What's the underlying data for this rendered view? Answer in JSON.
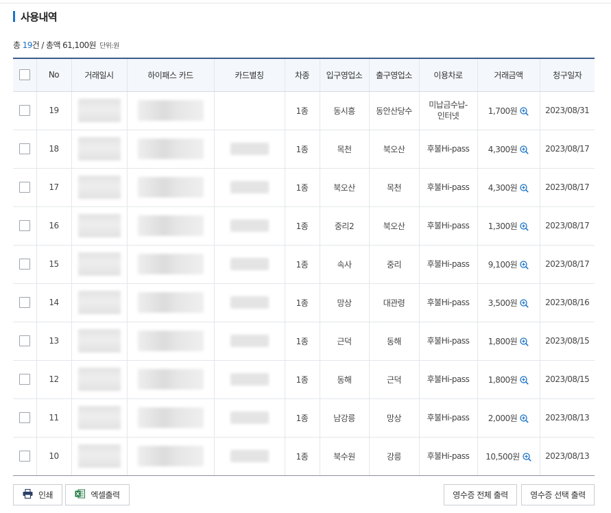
{
  "section": {
    "title": "사용내역"
  },
  "summary": {
    "prefix": "총 ",
    "count": "19",
    "middle": "건 / 총액 61,100원",
    "unit": "단위:원"
  },
  "table": {
    "headers": [
      "No",
      "거래일시",
      "하이패스 카드",
      "카드별칭",
      "차종",
      "입구영업소",
      "출구영업소",
      "이용차로",
      "거래금액",
      "청구일자"
    ],
    "rows": [
      {
        "no": "19",
        "nick_blurred": false,
        "vehicle": "1종",
        "entry": "동시흥",
        "exit": "동안산당수",
        "lane": "미납금수납-\n인터넷",
        "amount": "1,700원",
        "billing": "2023/08/31"
      },
      {
        "no": "18",
        "nick_blurred": true,
        "vehicle": "1종",
        "entry": "목천",
        "exit": "북오산",
        "lane": "후불Hi-pass",
        "amount": "4,300원",
        "billing": "2023/08/17"
      },
      {
        "no": "17",
        "nick_blurred": true,
        "vehicle": "1종",
        "entry": "북오산",
        "exit": "목천",
        "lane": "후불Hi-pass",
        "amount": "4,300원",
        "billing": "2023/08/17"
      },
      {
        "no": "16",
        "nick_blurred": true,
        "vehicle": "1종",
        "entry": "중리2",
        "exit": "북오산",
        "lane": "후불Hi-pass",
        "amount": "1,300원",
        "billing": "2023/08/17"
      },
      {
        "no": "15",
        "nick_blurred": true,
        "vehicle": "1종",
        "entry": "속사",
        "exit": "중리",
        "lane": "후불Hi-pass",
        "amount": "9,100원",
        "billing": "2023/08/17"
      },
      {
        "no": "14",
        "nick_blurred": true,
        "vehicle": "1종",
        "entry": "망상",
        "exit": "대관령",
        "lane": "후불Hi-pass",
        "amount": "3,500원",
        "billing": "2023/08/16"
      },
      {
        "no": "13",
        "nick_blurred": true,
        "vehicle": "1종",
        "entry": "근덕",
        "exit": "동해",
        "lane": "후불Hi-pass",
        "amount": "1,800원",
        "billing": "2023/08/15"
      },
      {
        "no": "12",
        "nick_blurred": true,
        "vehicle": "1종",
        "entry": "동해",
        "exit": "근덕",
        "lane": "후불Hi-pass",
        "amount": "1,800원",
        "billing": "2023/08/15"
      },
      {
        "no": "11",
        "nick_blurred": true,
        "vehicle": "1종",
        "entry": "남강릉",
        "exit": "망상",
        "lane": "후불Hi-pass",
        "amount": "2,000원",
        "billing": "2023/08/13"
      },
      {
        "no": "10",
        "nick_blurred": true,
        "vehicle": "1종",
        "entry": "북수원",
        "exit": "강릉",
        "lane": "후불Hi-pass",
        "amount": "10,500원",
        "billing": "2023/08/13"
      }
    ]
  },
  "buttons": {
    "print": "인쇄",
    "excel": "엑셀출력",
    "receipt_all": "영수증 전체 출력",
    "receipt_selected": "영수증 선택 출력"
  },
  "icons": {
    "zoom": "zoom-in-icon",
    "print": "printer-icon",
    "excel": "excel-icon"
  },
  "colors": {
    "accent": "#1a73c8",
    "header_bg": "#f4f7fb",
    "header_top_border": "#3a5a8c",
    "excel_green": "#1f7a3f",
    "print_navy": "#2b3f66"
  }
}
